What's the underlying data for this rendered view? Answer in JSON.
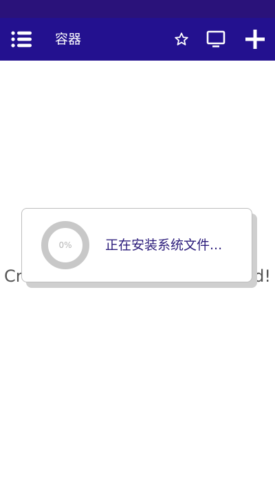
{
  "app_bar": {
    "title": "容器",
    "icons": [
      "menu-icon",
      "star-outline-icon",
      "monitor-icon",
      "plus-icon"
    ]
  },
  "background": {
    "partial_text_left": "Cr",
    "partial_text_right": "d!"
  },
  "dialog": {
    "progress_text": "0%",
    "progress_value": 0,
    "message": "正在安装系统文件..."
  },
  "colors": {
    "status_bar": "#2a127a",
    "app_bar": "#23118f",
    "message_text": "#2a1a7a",
    "ring": "#c8c8c8"
  }
}
